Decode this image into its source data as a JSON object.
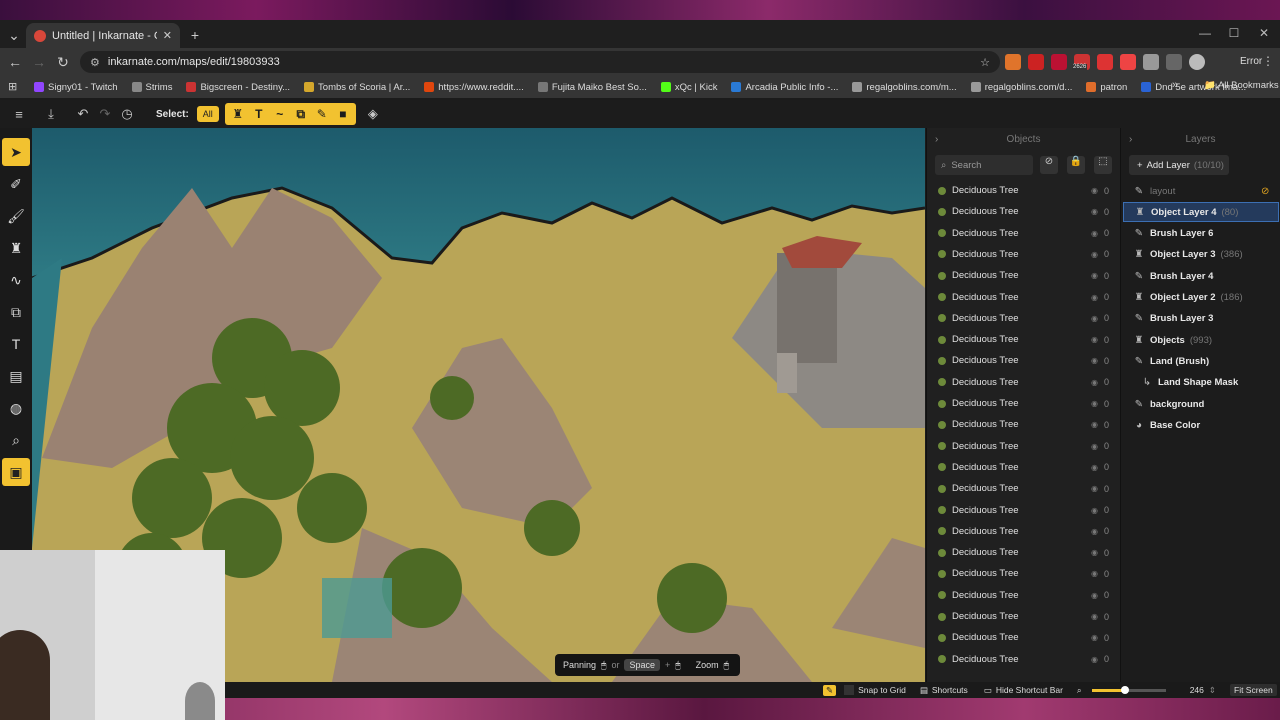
{
  "browser": {
    "tab_title": "Untitled | Inkarnate - Create Fa",
    "url": "inkarnate.com/maps/edit/19803933",
    "error_label": "Error",
    "all_bookmarks": "All Bookmarks",
    "ext_badge": "2626",
    "bookmarks": [
      "Signy01 - Twitch",
      "Strims",
      "Bigscreen - Destiny...",
      "Tombs of Scoria | Ar...",
      "https://www.reddit....",
      "Fujita Maiko Best So...",
      "xQc | Kick",
      "Arcadia Public Info -...",
      "regalgoblins.com/m...",
      "regalgoblins.com/d...",
      "patron",
      "Dnd 5e artwork Ima..."
    ]
  },
  "app": {
    "select_label": "Select:",
    "select_all": "All",
    "objects_panel": {
      "title": "Objects",
      "search_placeholder": "Search",
      "items": [
        {
          "name": "Deciduous Tree",
          "count": "0"
        },
        {
          "name": "Deciduous Tree",
          "count": "0"
        },
        {
          "name": "Deciduous Tree",
          "count": "0"
        },
        {
          "name": "Deciduous Tree",
          "count": "0"
        },
        {
          "name": "Deciduous Tree",
          "count": "0"
        },
        {
          "name": "Deciduous Tree",
          "count": "0"
        },
        {
          "name": "Deciduous Tree",
          "count": "0"
        },
        {
          "name": "Deciduous Tree",
          "count": "0"
        },
        {
          "name": "Deciduous Tree",
          "count": "0"
        },
        {
          "name": "Deciduous Tree",
          "count": "0"
        },
        {
          "name": "Deciduous Tree",
          "count": "0"
        },
        {
          "name": "Deciduous Tree",
          "count": "0"
        },
        {
          "name": "Deciduous Tree",
          "count": "0"
        },
        {
          "name": "Deciduous Tree",
          "count": "0"
        },
        {
          "name": "Deciduous Tree",
          "count": "0"
        },
        {
          "name": "Deciduous Tree",
          "count": "0"
        },
        {
          "name": "Deciduous Tree",
          "count": "0"
        },
        {
          "name": "Deciduous Tree",
          "count": "0"
        },
        {
          "name": "Deciduous Tree",
          "count": "0"
        },
        {
          "name": "Deciduous Tree",
          "count": "0"
        },
        {
          "name": "Deciduous Tree",
          "count": "0"
        },
        {
          "name": "Deciduous Tree",
          "count": "0"
        },
        {
          "name": "Deciduous Tree",
          "count": "0"
        }
      ]
    },
    "layers_panel": {
      "title": "Layers",
      "add_layer": "Add Layer",
      "add_layer_count": "(10/10)",
      "layers": [
        {
          "name": "layout",
          "count": "",
          "icon": "pencil-icon"
        },
        {
          "name": "Object Layer 4",
          "count": "(80)",
          "icon": "tower-icon"
        },
        {
          "name": "Brush Layer 6",
          "count": "",
          "icon": "pencil-icon"
        },
        {
          "name": "Object Layer 3",
          "count": "(386)",
          "icon": "tower-icon"
        },
        {
          "name": "Brush Layer 4",
          "count": "",
          "icon": "pencil-icon"
        },
        {
          "name": "Object Layer 2",
          "count": "(186)",
          "icon": "tower-icon"
        },
        {
          "name": "Brush Layer 3",
          "count": "",
          "icon": "pencil-icon"
        },
        {
          "name": "Objects",
          "count": "(993)",
          "icon": "tower-icon"
        },
        {
          "name": "Land (Brush)",
          "count": "",
          "icon": "pencil-icon"
        },
        {
          "name": "Land Shape Mask",
          "count": "",
          "icon": "mask-icon"
        },
        {
          "name": "background",
          "count": "",
          "icon": "pencil-icon"
        },
        {
          "name": "Base Color",
          "count": "",
          "icon": "palette-icon"
        }
      ]
    },
    "hint_bar": {
      "panning": "Panning",
      "or": "or",
      "space": "Space",
      "plus": "+",
      "zoom": "Zoom"
    },
    "status_bar": {
      "snap": "Snap to Grid",
      "shortcuts": "Shortcuts",
      "hide": "Hide Shortcut Bar",
      "zoom_value": "246",
      "fit": "Fit Screen"
    },
    "zoom_level": 0.45
  }
}
